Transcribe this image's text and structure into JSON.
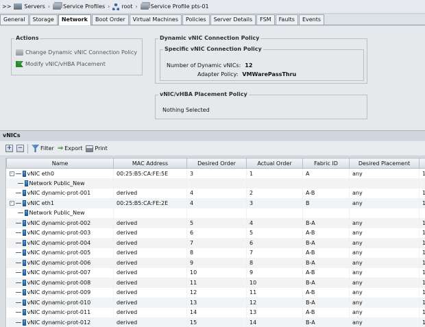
{
  "breadcrumb": {
    "prefix": ">>",
    "items": [
      {
        "label": "Servers",
        "icon": "server-icon"
      },
      {
        "label": "Service Profiles",
        "icon": "service-profiles-icon"
      },
      {
        "label": "root",
        "icon": "org-tree-icon"
      },
      {
        "label": "Service Profile pts-01",
        "icon": "service-profile-icon"
      }
    ]
  },
  "tabs": [
    {
      "label": "General",
      "active": false
    },
    {
      "label": "Storage",
      "active": false
    },
    {
      "label": "Network",
      "active": true
    },
    {
      "label": "Boot Order",
      "active": false
    },
    {
      "label": "Virtual Machines",
      "active": false
    },
    {
      "label": "Policies",
      "active": false
    },
    {
      "label": "Server Details",
      "active": false
    },
    {
      "label": "FSM",
      "active": false
    },
    {
      "label": "Faults",
      "active": false
    },
    {
      "label": "Events",
      "active": false
    }
  ],
  "actions": {
    "title": "Actions",
    "items": [
      {
        "label": "Change Dynamic vNIC Connection Policy",
        "icon": "change-policy-icon"
      },
      {
        "label": "Modify vNIC/vHBA Placement",
        "icon": "flag-icon"
      }
    ]
  },
  "dynamic_policy": {
    "title": "Dynamic vNIC Connection Policy",
    "specific_title": "Specific vNIC Connection Policy",
    "num_label": "Number of Dynamic vNICs:",
    "num_value": "12",
    "adapter_label": "Adapter Policy:",
    "adapter_value": "VMWarePassThru"
  },
  "placement_policy": {
    "title": "vNIC/vHBA Placement Policy",
    "value": "Nothing Selected"
  },
  "vnics": {
    "title": "vNICs",
    "toolbar": {
      "filter": "Filter",
      "export": "Export",
      "print": "Print"
    },
    "columns": [
      "Name",
      "MAC Address",
      "Desired Order",
      "Actual Order",
      "Fabric ID",
      "Desired Placement"
    ],
    "rows": [
      {
        "name": "vNIC eth0",
        "level": 0,
        "expander": "-",
        "mac": "00:25:B5:CA:FE:5E",
        "desired": "3",
        "actual": "1",
        "fabric": "A",
        "placement": "any",
        "extra": "1"
      },
      {
        "name": "Network Public_New",
        "level": 1,
        "expander": "",
        "mac": "",
        "desired": "",
        "actual": "",
        "fabric": "",
        "placement": "",
        "extra": ""
      },
      {
        "name": "vNIC dynamic-prot-001",
        "level": 0,
        "expander": "",
        "mac": "derived",
        "desired": "4",
        "actual": "2",
        "fabric": "A-B",
        "placement": "any",
        "extra": "1"
      },
      {
        "name": "vNIC eth1",
        "level": 0,
        "expander": "-",
        "mac": "00:25:B5:CA:FE:2E",
        "desired": "4",
        "actual": "3",
        "fabric": "B",
        "placement": "any",
        "extra": "1"
      },
      {
        "name": "Network Public_New",
        "level": 1,
        "expander": "",
        "mac": "",
        "desired": "",
        "actual": "",
        "fabric": "",
        "placement": "",
        "extra": ""
      },
      {
        "name": "vNIC dynamic-prot-002",
        "level": 0,
        "expander": "",
        "mac": "derived",
        "desired": "5",
        "actual": "4",
        "fabric": "B-A",
        "placement": "any",
        "extra": "1"
      },
      {
        "name": "vNIC dynamic-prot-003",
        "level": 0,
        "expander": "",
        "mac": "derived",
        "desired": "6",
        "actual": "5",
        "fabric": "A-B",
        "placement": "any",
        "extra": "1"
      },
      {
        "name": "vNIC dynamic-prot-004",
        "level": 0,
        "expander": "",
        "mac": "derived",
        "desired": "7",
        "actual": "6",
        "fabric": "B-A",
        "placement": "any",
        "extra": "1"
      },
      {
        "name": "vNIC dynamic-prot-005",
        "level": 0,
        "expander": "",
        "mac": "derived",
        "desired": "8",
        "actual": "7",
        "fabric": "A-B",
        "placement": "any",
        "extra": "1"
      },
      {
        "name": "vNIC dynamic-prot-006",
        "level": 0,
        "expander": "",
        "mac": "derived",
        "desired": "9",
        "actual": "8",
        "fabric": "B-A",
        "placement": "any",
        "extra": "1"
      },
      {
        "name": "vNIC dynamic-prot-007",
        "level": 0,
        "expander": "",
        "mac": "derived",
        "desired": "10",
        "actual": "9",
        "fabric": "A-B",
        "placement": "any",
        "extra": "1"
      },
      {
        "name": "vNIC dynamic-prot-008",
        "level": 0,
        "expander": "",
        "mac": "derived",
        "desired": "11",
        "actual": "10",
        "fabric": "B-A",
        "placement": "any",
        "extra": "1"
      },
      {
        "name": "vNIC dynamic-prot-009",
        "level": 0,
        "expander": "",
        "mac": "derived",
        "desired": "12",
        "actual": "11",
        "fabric": "A-B",
        "placement": "any",
        "extra": "1"
      },
      {
        "name": "vNIC dynamic-prot-010",
        "level": 0,
        "expander": "",
        "mac": "derived",
        "desired": "13",
        "actual": "12",
        "fabric": "B-A",
        "placement": "any",
        "extra": "1"
      },
      {
        "name": "vNIC dynamic-prot-011",
        "level": 0,
        "expander": "",
        "mac": "derived",
        "desired": "14",
        "actual": "13",
        "fabric": "A-B",
        "placement": "any",
        "extra": "1"
      },
      {
        "name": "vNIC dynamic-prot-012",
        "level": 0,
        "expander": "",
        "mac": "derived",
        "desired": "15",
        "actual": "14",
        "fabric": "B-A",
        "placement": "any",
        "extra": "1"
      }
    ]
  }
}
